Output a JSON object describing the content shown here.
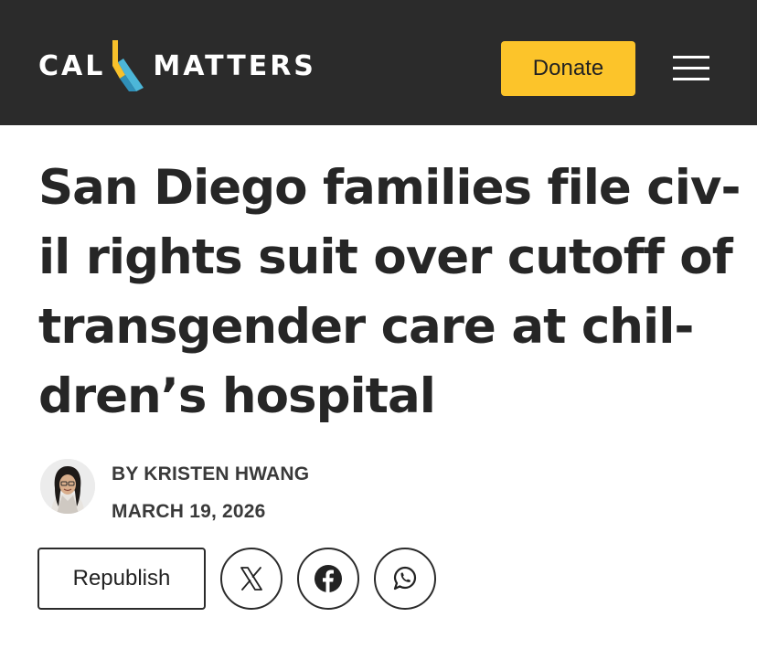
{
  "header": {
    "logo_left": "CAL",
    "logo_right": "MATTERS",
    "donate_label": "Donate",
    "menu_icon": "hamburger-menu-icon",
    "colors": {
      "background": "#2b2b2b",
      "donate": "#fcc42a",
      "logo_yellow": "#f8c12b",
      "logo_blue": "#4cb6d8"
    }
  },
  "article": {
    "headline_lines": [
      "San Diego families file civ-",
      "il rights suit over cutoff of",
      "transgender care at chil-",
      "dren’s hospital"
    ],
    "byline": "BY KRISTEN HWANG",
    "date": "MARCH 19, 2026"
  },
  "actions": {
    "republish_label": "Republish",
    "share_icons": [
      "x-icon",
      "facebook-icon",
      "whatsapp-icon"
    ]
  }
}
